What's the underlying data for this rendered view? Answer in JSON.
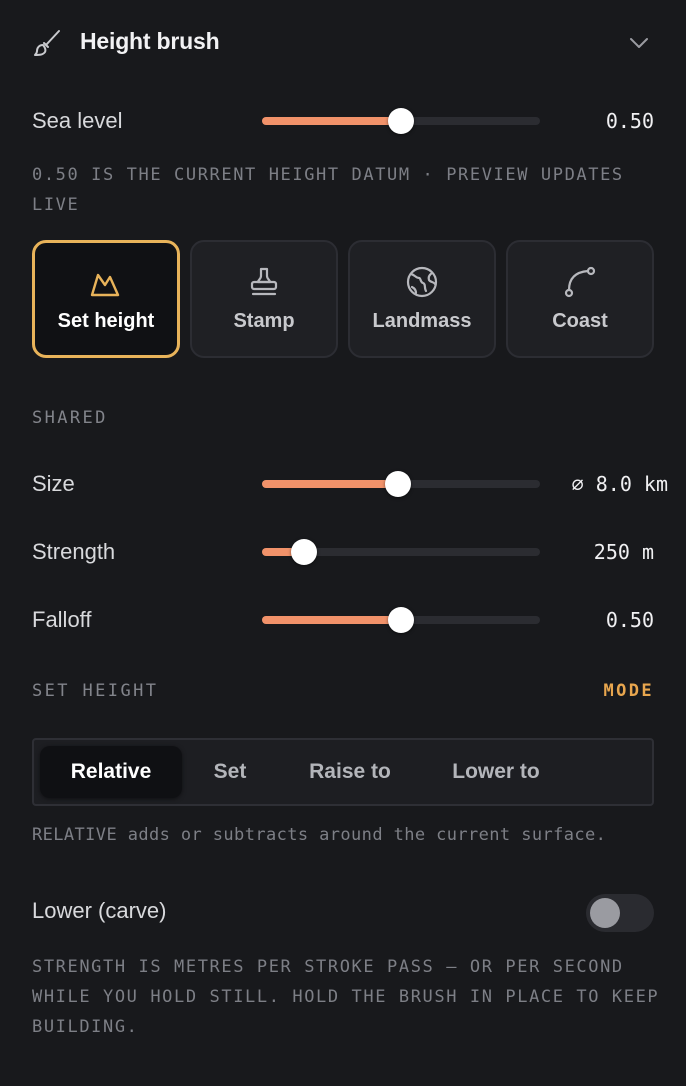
{
  "panel": {
    "title": "Height brush",
    "icon": "paintbrush-icon",
    "collapse_icon": "chevron-down-icon"
  },
  "sea_level": {
    "label": "Sea level",
    "value_text": "0.50",
    "fraction": 0.5
  },
  "datum_note": "0.50 IS THE CURRENT HEIGHT DATUM · PREVIEW UPDATES LIVE",
  "modes": [
    {
      "label": "Set height",
      "icon": "mountain-icon",
      "active": true
    },
    {
      "label": "Stamp",
      "icon": "stamp-icon",
      "active": false
    },
    {
      "label": "Landmass",
      "icon": "globe-icon",
      "active": false
    },
    {
      "label": "Coast",
      "icon": "curve-path-icon",
      "active": false
    }
  ],
  "shared": {
    "heading": "SHARED",
    "size": {
      "label": "Size",
      "value_text": "⌀ 8.0 km",
      "fraction": 0.49
    },
    "strength": {
      "label": "Strength",
      "value_text": "250 m",
      "fraction": 0.15
    },
    "falloff": {
      "label": "Falloff",
      "value_text": "0.50",
      "fraction": 0.5
    }
  },
  "set_height": {
    "heading": "SET HEIGHT",
    "mode_link": "MODE",
    "options": [
      "Relative",
      "Set",
      "Raise to",
      "Lower to"
    ],
    "selected": "Relative",
    "note": "RELATIVE adds or subtracts around the current surface."
  },
  "lower_toggle": {
    "label": "Lower (carve)",
    "on": false
  },
  "strength_note": "STRENGTH IS METRES PER STROKE PASS — OR PER SECOND WHILE YOU HOLD STILL. HOLD THE BRUSH IN PLACE TO KEEP BUILDING.",
  "colors": {
    "accent": "#f1926a",
    "active_border": "#e8b35a",
    "mode_link": "#e8a64e"
  }
}
